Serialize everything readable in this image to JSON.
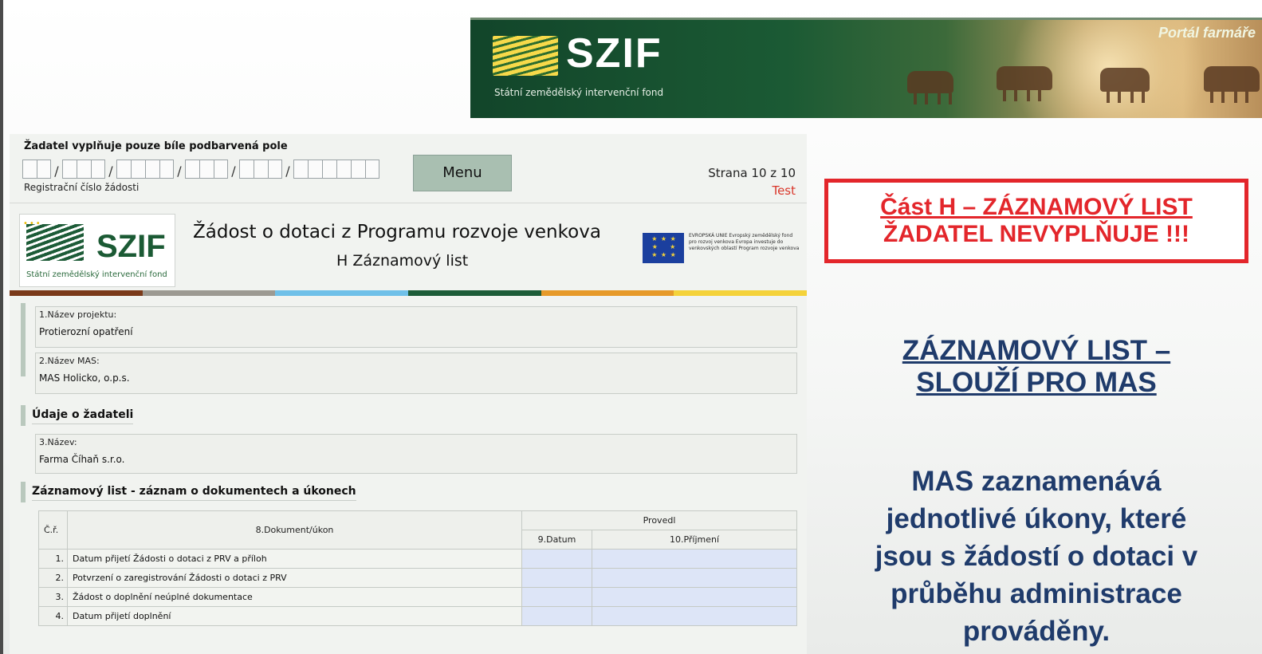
{
  "banner": {
    "brand": "SZIF",
    "brand_subtitle": "Státní zemědělský intervenční fond",
    "portal_label": "Portál farmáře"
  },
  "form": {
    "notice": "Žadatel vyplňuje pouze bíle podbarvená pole",
    "reg_label": "Registrační číslo žádosti",
    "menu_label": "Menu",
    "page_label": "Strana 10 z 10",
    "test_label": "Test",
    "logo_mark": "SZIF",
    "logo_sub": "Státní zemědělský intervenční fond",
    "title": "Žádost o dotaci z Programu rozvoje venkova",
    "subtitle": "H Záznamový list",
    "eu_text": "EVROPSKÁ UNIE Evropský zemědělský fond pro rozvoj venkova Evropa investuje do venkovských oblastí Program rozvoje venkova",
    "colorbar": [
      "#7a3a1a",
      "#9c9a92",
      "#6fc0e8",
      "#1d5c38",
      "#e69a2a",
      "#f4d23a"
    ],
    "fields": [
      {
        "label": "1.Název projektu:",
        "value": "Protierozní opatření"
      },
      {
        "label": "2.Název MAS:",
        "value": "MAS Holicko, o.p.s."
      }
    ],
    "section_applicant": "Údaje o žadateli",
    "applicant_field": {
      "label": "3.Název:",
      "value": "Farma Číhaň s.r.o."
    },
    "section_record": "Záznamový list - záznam o dokumentech a úkonech",
    "table": {
      "col_no": "Č.ř.",
      "col_doc": "8.Dokument/úkon",
      "col_group": "Provedl",
      "col_date": "9.Datum",
      "col_name": "10.Příjmení",
      "rows": [
        {
          "no": "1.",
          "text": "Datum přijetí Žádosti o dotaci z PRV a příloh"
        },
        {
          "no": "2.",
          "text": "Potvrzení o zaregistrování Žádosti o dotaci z PRV"
        },
        {
          "no": "3.",
          "text": "Žádost o doplnění neúplné dokumentace"
        },
        {
          "no": "4.",
          "text": "Datum přijetí doplnění"
        }
      ]
    }
  },
  "panel": {
    "red_line1": "Část H – ZÁZNAMOVÝ LIST",
    "red_line2": "ŽADATEL NEVYPLŇUJE !!!",
    "heading_line1": "ZÁZNAMOVÝ LIST –",
    "heading_line2": "SLOUŽÍ PRO MAS",
    "body_line1": "MAS zaznamenává",
    "body_line2": "jednotlivé úkony, které",
    "body_line3": "jsou s žádostí o dotaci v",
    "body_line4": "průběhu administrace",
    "body_line5": "prováděny."
  },
  "colors": {
    "banner_green": "#1b5a34",
    "red_accent": "#e3262b",
    "navy_text": "#1f3b6b",
    "input_blue": "#dde5f7",
    "menu_button": "#a9bfb1"
  }
}
